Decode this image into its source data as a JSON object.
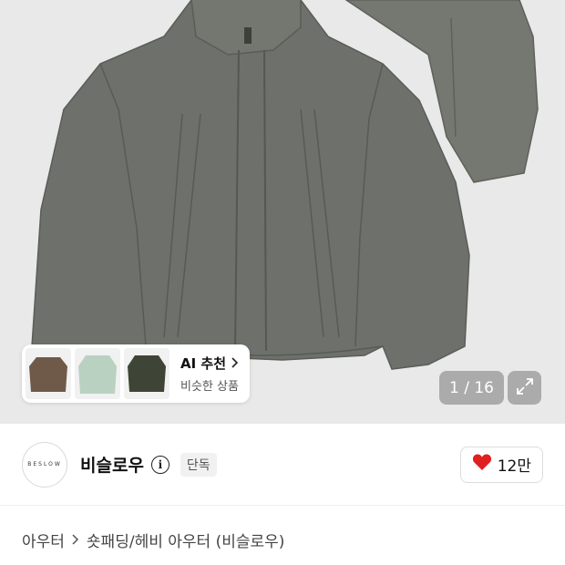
{
  "gallery": {
    "counter_text": "1 / 16",
    "expand_icon": "expand-icon"
  },
  "ai_recommend": {
    "title": "AI 추천",
    "subtitle": "비슷한 상품",
    "chevron_icon": "chevron-right-icon",
    "thumb_colors": [
      "#6f5a4a",
      "#b9d1c1",
      "#3f4536"
    ]
  },
  "brand": {
    "logo_text": "BESLOW",
    "name": "비슬로우",
    "info_icon": "info-icon",
    "badge": "단독",
    "likes": "12만",
    "heart_color": "#e02020"
  },
  "breadcrumb": {
    "items": [
      "아우터",
      "숏패딩/헤비 아우터 (비슬로우)"
    ]
  },
  "colors": {
    "jacket": "#6e716b",
    "background": "#e9e9e9"
  }
}
